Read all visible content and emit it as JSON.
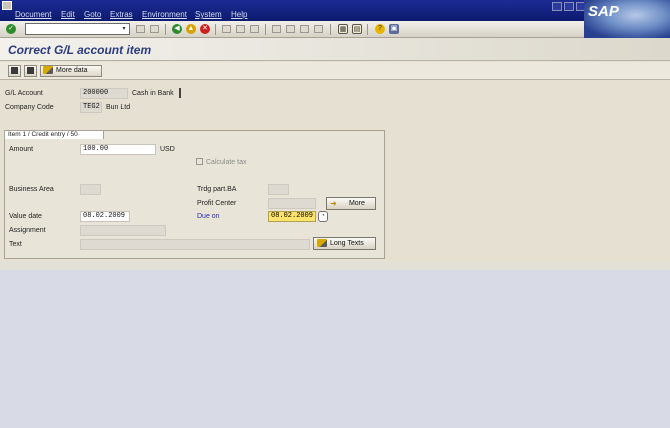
{
  "menubar": {
    "items": [
      "Document",
      "Edit",
      "Goto",
      "Extras",
      "Environment",
      "System",
      "Help"
    ],
    "logo": "SAP"
  },
  "toolbar": {
    "command_field": "",
    "icons": [
      "enter-icon",
      "save-icon",
      "back-icon",
      "exit-icon",
      "cancel-icon",
      "print-icon",
      "find-icon",
      "find-next-icon",
      "first-page-icon",
      "prev-page-icon",
      "next-page-icon",
      "last-page-icon",
      "new-session-icon",
      "shortcut-icon",
      "help-icon",
      "layout-icon"
    ]
  },
  "title": "Correct G/L account item",
  "app_toolbar": {
    "more_data_label": "More data"
  },
  "header": {
    "gl_account_label": "G/L Account",
    "gl_account_value": "200000",
    "gl_account_text": "Cash in Bank",
    "company_code_label": "Company Code",
    "company_code_value": "TEG2",
    "company_code_text": "Bun Ltd"
  },
  "item": {
    "tab_label": "Item 1 / Credit entry / 50",
    "amount_label": "Amount",
    "amount_value": "100.00",
    "currency": "USD",
    "calculate_tax_label": "Calculate tax",
    "business_area_label": "Business Area",
    "business_area_value": "",
    "trdg_part_label": "Trdg part.BA",
    "trdg_part_value": "",
    "profit_center_label": "Profit Center",
    "profit_center_value": "",
    "more_label": "More",
    "value_date_label": "Value date",
    "value_date_value": "08.02.2009",
    "due_on_label": "Due on",
    "due_on_value": "08.02.2009",
    "assignment_label": "Assignment",
    "assignment_value": "",
    "text_label": "Text",
    "text_value": "",
    "long_texts_label": "Long Texts"
  },
  "colors": {
    "menubar": "#0c1a6e",
    "title": "#2c3c7c",
    "highlight": "#ffe36a",
    "due_on_label": "#2a2ab0"
  }
}
